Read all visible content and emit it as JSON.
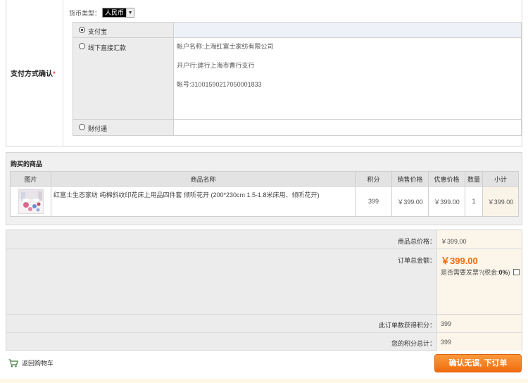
{
  "payment": {
    "label": "支付方式确认",
    "required_mark": "*",
    "currency_label": "货币类型：",
    "currency_value": "人民币",
    "methods": [
      {
        "name": "支付宝",
        "selected": true
      },
      {
        "name": "线下直接汇款",
        "selected": false
      },
      {
        "name": "财付通",
        "selected": false
      }
    ],
    "bank_info": {
      "account_name": "帐户名称:上海红富士家纺有限公司",
      "bank": "开户行:建行上海市曹行支行",
      "account_no": "帐号:31001590217050001833"
    }
  },
  "goods": {
    "title": "购买的商品",
    "headers": [
      "图片",
      "商品名称",
      "积分",
      "销售价格",
      "优惠价格",
      "数量",
      "小计"
    ],
    "items": [
      {
        "name": "红富士生态家纺 纯棉斜纹印花床上用品四件套 倾听花开 (200*230cm 1.5-1.8米床用、倾听花开)",
        "points": "399",
        "price": "￥399.00",
        "discount_price": "￥399.00",
        "qty": "1",
        "subtotal": "￥399.00"
      }
    ]
  },
  "totals": {
    "goods_total_label": "商品总价格：",
    "goods_total": "￥399.00",
    "order_total_label": "订单总金额：",
    "order_total": "￥399.00",
    "invoice_prefix": "是否需要发票?(税金:",
    "invoice_rate": "0%",
    "invoice_suffix": ")",
    "earned_points_label": "此订单数获得积分：",
    "earned_points": "399",
    "total_points_label": "您的积分总计：",
    "total_points": "399"
  },
  "actions": {
    "back_to_cart": "返回购物车",
    "confirm": "确认无误, 下订单"
  },
  "colors": {
    "accent": "#f26a0c",
    "button_top": "#fb9a3c",
    "button_bottom": "#f06b10",
    "selected_row": "#eef2f8"
  }
}
